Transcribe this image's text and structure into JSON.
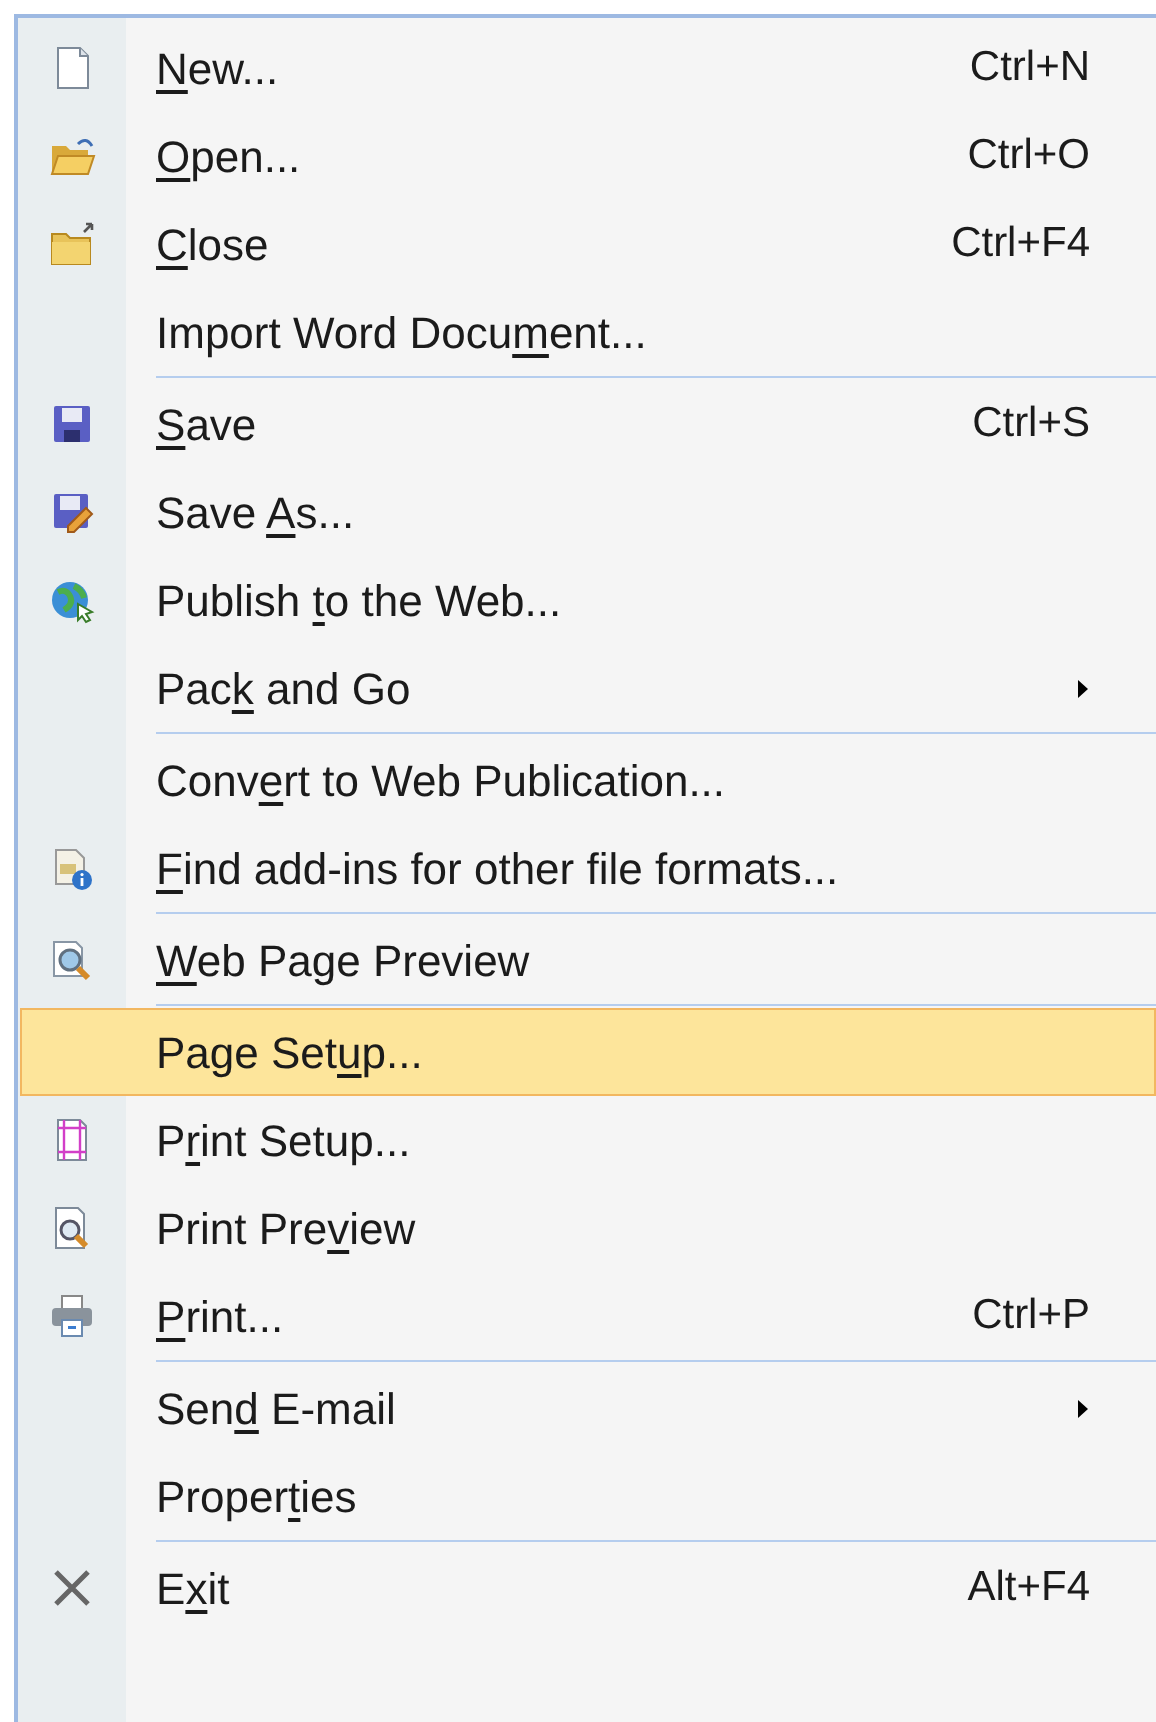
{
  "menu": {
    "items": [
      {
        "label": {
          "key": "N",
          "after": "ew..."
        },
        "shortcut": "Ctrl+N",
        "submenu": false,
        "selected": false,
        "separator_after": false
      },
      {
        "label": {
          "key": "O",
          "after": "pen..."
        },
        "shortcut": "Ctrl+O",
        "submenu": false,
        "selected": false,
        "separator_after": false
      },
      {
        "label": {
          "key": "C",
          "after": "lose"
        },
        "shortcut": "Ctrl+F4",
        "submenu": false,
        "selected": false,
        "separator_after": false
      },
      {
        "label": {
          "before": "Import Word Docu",
          "key": "m",
          "after": "ent..."
        },
        "submenu": false,
        "selected": false,
        "separator_after": true
      },
      {
        "label": {
          "key": "S",
          "after": "ave"
        },
        "shortcut": "Ctrl+S",
        "submenu": false,
        "selected": false,
        "separator_after": false
      },
      {
        "label": {
          "before": "Save ",
          "key": "A",
          "after": "s..."
        },
        "submenu": false,
        "selected": false,
        "separator_after": false
      },
      {
        "label": {
          "before": "Publish ",
          "key": "t",
          "after": "o the Web..."
        },
        "submenu": false,
        "selected": false,
        "separator_after": false
      },
      {
        "label": {
          "before": "Pac",
          "key": "k",
          "after": " and Go"
        },
        "submenu": true,
        "selected": false,
        "separator_after": true
      },
      {
        "label": {
          "before": "Conv",
          "key": "e",
          "after": "rt to Web Publication..."
        },
        "submenu": false,
        "selected": false,
        "separator_after": false
      },
      {
        "label": {
          "key": "F",
          "after": "ind add-ins for other file formats..."
        },
        "submenu": false,
        "selected": false,
        "separator_after": true
      },
      {
        "label": {
          "key": "W",
          "after": "eb Page Preview"
        },
        "submenu": false,
        "selected": false,
        "separator_after": true
      },
      {
        "label": {
          "before": "Page Set",
          "key": "u",
          "after": "p..."
        },
        "submenu": false,
        "selected": true,
        "separator_after": false
      },
      {
        "label": {
          "before": "P",
          "key": "r",
          "after": "int Setup..."
        },
        "submenu": false,
        "selected": false,
        "separator_after": false
      },
      {
        "label": {
          "before": "Print Pre",
          "key": "v",
          "after": "iew"
        },
        "submenu": false,
        "selected": false,
        "separator_after": false
      },
      {
        "label": {
          "key": "P",
          "after": "rint..."
        },
        "shortcut": "Ctrl+P",
        "submenu": false,
        "selected": false,
        "separator_after": true
      },
      {
        "label": {
          "before": "Sen",
          "key": "d",
          "after": " E-mail"
        },
        "submenu": true,
        "selected": false,
        "separator_after": false
      },
      {
        "label": {
          "before": "Proper",
          "key": "t",
          "after": "ies"
        },
        "submenu": false,
        "selected": false,
        "separator_after": true
      },
      {
        "label": {
          "before": "E",
          "key": "x",
          "after": "it"
        },
        "shortcut": "Alt+F4",
        "submenu": false,
        "selected": false,
        "separator_after": false
      }
    ]
  }
}
